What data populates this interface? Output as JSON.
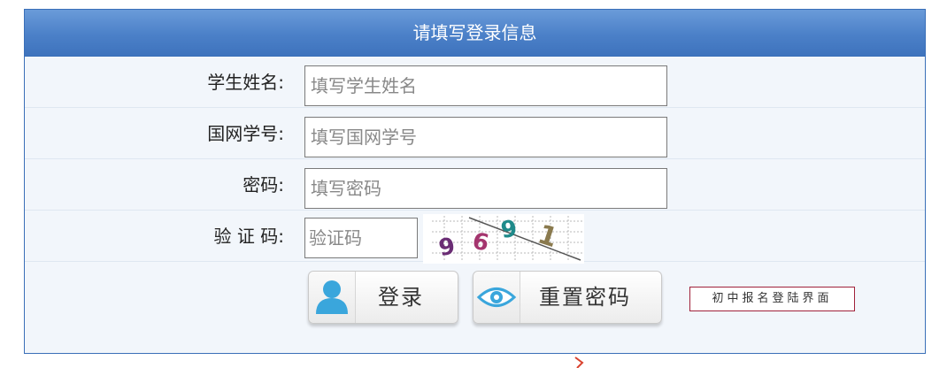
{
  "header": {
    "title": "请填写登录信息"
  },
  "form": {
    "name": {
      "label": "学生姓名:",
      "placeholder": "填写学生姓名"
    },
    "id": {
      "label": "国网学号:",
      "placeholder": "填写国网学号"
    },
    "password": {
      "label": "密码:",
      "placeholder": "填写密码"
    },
    "captcha": {
      "label": "验 证 码:",
      "placeholder": "验证码",
      "code": [
        "9",
        "6",
        "9",
        "1"
      ]
    }
  },
  "buttons": {
    "login": {
      "label": "登录",
      "icon": "user-icon"
    },
    "reset": {
      "label": "重置密码",
      "icon": "eye-icon"
    }
  },
  "tag": "初中报名登陆界面",
  "colors": {
    "header": "#4b80c8",
    "accent_blue": "#3aa6dc",
    "tag_border": "#a0213a"
  }
}
